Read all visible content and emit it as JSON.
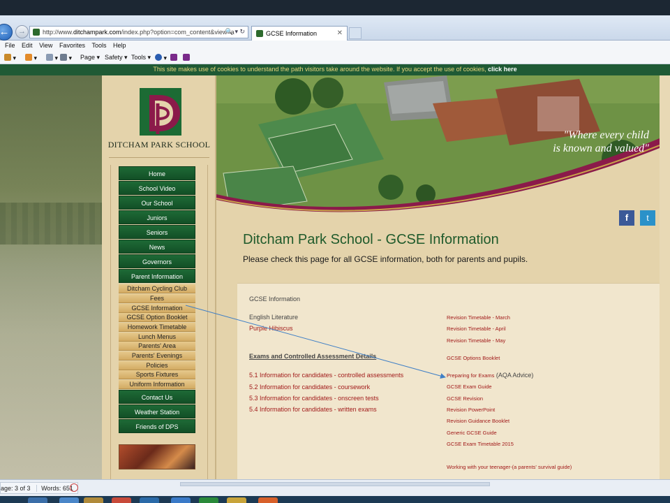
{
  "browser": {
    "url_prefix": "http://www.",
    "url_domain": "ditchampark.com",
    "url_rest": "/index.php?option=com_content&view=a",
    "tab_title": "GCSE Information",
    "menu": [
      "File",
      "Edit",
      "View",
      "Favorites",
      "Tools",
      "Help"
    ],
    "commands": {
      "page": "Page ▾",
      "safety": "Safety ▾",
      "tools": "Tools ▾"
    }
  },
  "cookie_bar": {
    "message": "This site makes use of cookies to understand the path visitors take around the website. If you accept the use of cookies, ",
    "link": "click here"
  },
  "school": {
    "name": "Ditcham Park School",
    "tagline_1": "\"Where every child",
    "tagline_2": "is known and valued\""
  },
  "nav": {
    "main_top": [
      "Home",
      "School Video",
      "Our School",
      "Juniors",
      "Seniors",
      "News",
      "Governors",
      "Parent Information"
    ],
    "sub": [
      "Ditcham Cycling Club",
      "Fees",
      "GCSE Information",
      "GCSE Option Booklet",
      "Homework Timetable",
      "Lunch Menus",
      "Parents' Area",
      "Parents' Evenings",
      "Policies",
      "Sports Fixtures",
      "Uniform Information"
    ],
    "main_bottom": [
      "Contact Us",
      "Weather Station",
      "Friends of DPS"
    ]
  },
  "social": {
    "facebook": "f",
    "twitter": "t"
  },
  "content": {
    "title": "Ditcham Park School - GCSE Information",
    "subtitle": "Please check this page for all GCSE information, both for parents and pupils.",
    "panel_heading": "GCSE Information",
    "english_lit": "English Literature",
    "purple_hibiscus": "Purple Hibiscus",
    "exams_heading": "Exams and Controlled Assessment Details",
    "left_links": [
      "5.1 Information for candidates - controlled assessments",
      "5.2 Information for candidates - coursework",
      "5.3 Information for candidates - onscreen tests",
      "5.4 Information for candidates - written exams"
    ],
    "right_links": {
      "rev_march": "Revision Timetable - March",
      "rev_april": "Revision Timetable - April",
      "rev_may": "Revision Timetable - May",
      "options_booklet": "GCSE Options Booklet",
      "preparing": "Preparing for Exams",
      "aqa_advice": " (AQA Advice)",
      "exam_guide": "GCSE Exam Guide",
      "revision": "GCSE Revision",
      "powerpoint": "Revision PowerPoint",
      "guidance": "Revision Guidance Booklet",
      "generic": "Generic GCSE Guide",
      "timetable_2015": "GCSE Exam Timetable 2015",
      "teenager": "Working with your teenager-(a parents' survival guide)"
    }
  },
  "statusbar": {
    "page": "age: 3 of 3",
    "words": "Words: 651"
  },
  "colors": {
    "green": "#1f5a2b",
    "maroon": "#8b1a4a",
    "gold": "#e4d3ab",
    "link_red": "#a11a1a"
  }
}
